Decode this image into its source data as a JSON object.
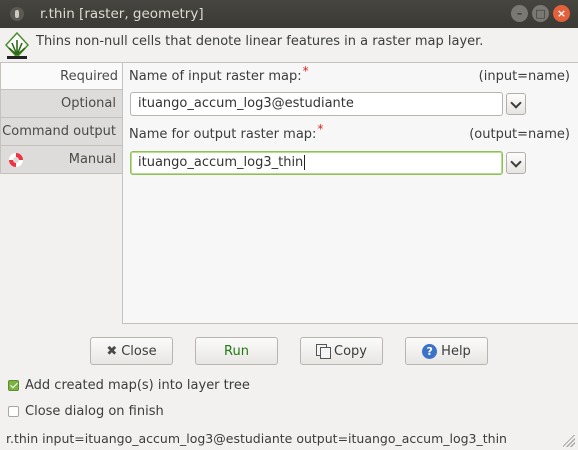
{
  "window": {
    "title": "r.thin [raster, geometry]"
  },
  "description": "Thins non-null cells that denote linear features in a raster map layer.",
  "tabs": [
    {
      "label": "Required",
      "active": true
    },
    {
      "label": "Optional",
      "active": false
    },
    {
      "label": "Command output",
      "active": false
    },
    {
      "label": "Manual",
      "active": false,
      "icon": "lifebuoy-icon"
    }
  ],
  "inputs": {
    "input": {
      "label": "Name of input raster map:",
      "required_mark": "*",
      "hint": "(input=name)",
      "value": "ituango_accum_log3@estudiante"
    },
    "output": {
      "label": "Name for output raster map:",
      "required_mark": "*",
      "hint": "(output=name)",
      "value": "ituango_accum_log3_thin"
    }
  },
  "buttons": {
    "close": "Close",
    "run": "Run",
    "copy": "Copy",
    "help": "Help"
  },
  "checkboxes": [
    {
      "label": "Add created map(s) into layer tree",
      "checked": true
    },
    {
      "label": "Close dialog on finish",
      "checked": false
    }
  ],
  "command_line": "r.thin input=ituango_accum_log3@estudiante output=ituango_accum_log3_thin",
  "colors": {
    "run_text": "#1f7a12",
    "required_mark": "#e0241b",
    "checkbox_on": "#7cb342",
    "close_button": "#e2603a"
  }
}
